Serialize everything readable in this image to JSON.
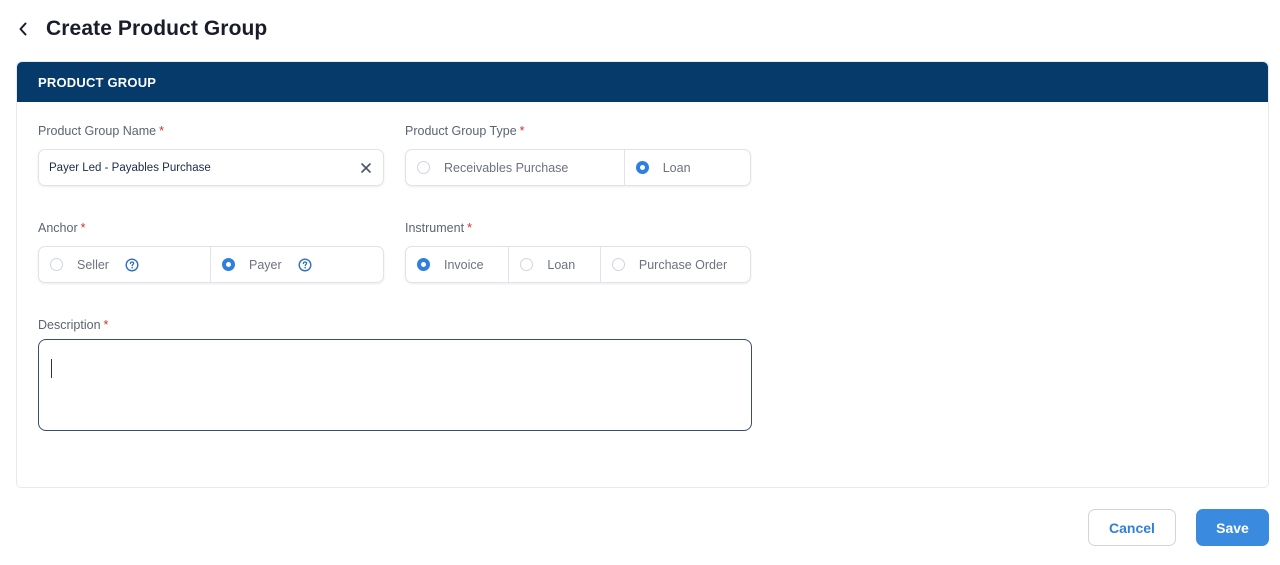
{
  "header": {
    "title": "Create Product Group"
  },
  "section": {
    "title": "PRODUCT GROUP"
  },
  "form": {
    "name": {
      "label": "Product Group Name",
      "required": "*",
      "value": "Payer Led - Payables Purchase"
    },
    "type": {
      "label": "Product Group Type",
      "required": "*",
      "options": [
        {
          "label": "Receivables Purchase",
          "selected": false
        },
        {
          "label": "Loan",
          "selected": true
        }
      ]
    },
    "anchor": {
      "label": "Anchor",
      "required": "*",
      "options": [
        {
          "label": "Seller",
          "selected": false
        },
        {
          "label": "Payer",
          "selected": true
        }
      ]
    },
    "instrument": {
      "label": "Instrument",
      "required": "*",
      "options": [
        {
          "label": "Invoice",
          "selected": true
        },
        {
          "label": "Loan",
          "selected": false
        },
        {
          "label": "Purchase Order",
          "selected": false
        }
      ]
    },
    "description": {
      "label": "Description",
      "required": "*",
      "value": ""
    }
  },
  "actions": {
    "cancel": "Cancel",
    "save": "Save"
  },
  "colors": {
    "primary": "#2f7fdc",
    "header_bg": "#053a6b",
    "required": "#d32f2f"
  },
  "icons": {
    "back": "chevron-left-icon",
    "clear": "close-icon",
    "help": "question-circle-icon"
  }
}
